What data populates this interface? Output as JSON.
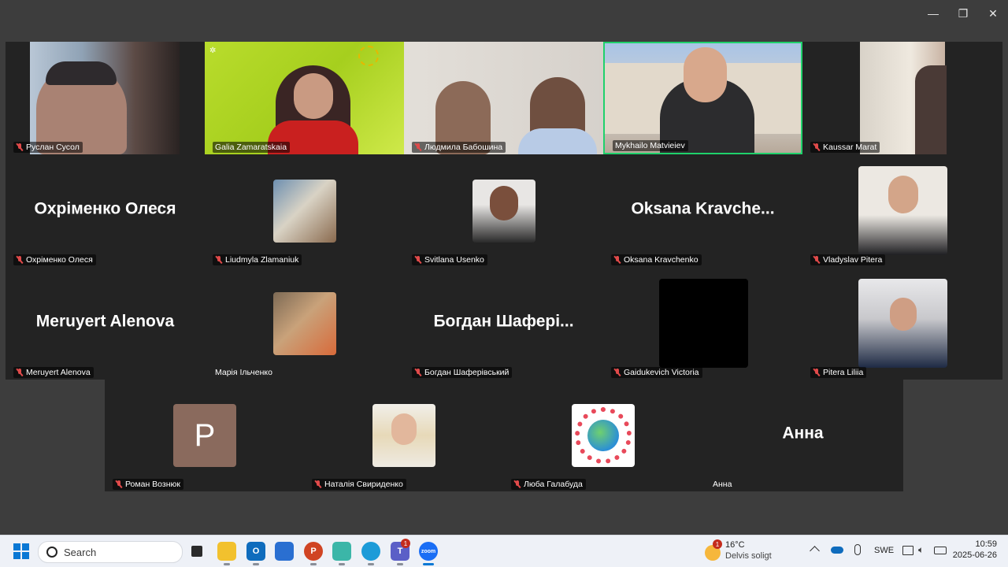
{
  "window_controls": {
    "minimize": "—",
    "maximize": "❐",
    "close": "✕"
  },
  "participants": {
    "row1": [
      {
        "name": "Руслан Сусол"
      },
      {
        "name": "Galia Zamaratskaia"
      },
      {
        "name": "Людмила Бабошина"
      },
      {
        "name": "Mykhailo Matvieiev"
      },
      {
        "name": "Kaussar Marat"
      }
    ],
    "row2": [
      {
        "name": "Охріменко Олеся",
        "big": "Охріменко Олеся"
      },
      {
        "name": "Liudmyla Zlamaniuk"
      },
      {
        "name": "Svitlana Usenko"
      },
      {
        "name": "Oksana Kravchenko",
        "big": "Oksana  Kravche..."
      },
      {
        "name": "Vladyslav Pitera"
      }
    ],
    "row3": [
      {
        "name": "Meruyert Alenova",
        "big": "Meruyert Alenova"
      },
      {
        "name": "Марія Ільченко"
      },
      {
        "name": "Богдан Шаферівський",
        "big": "Богдан  Шафері..."
      },
      {
        "name": "Gaidukevich Victoria"
      },
      {
        "name": "Pitera Liliia"
      }
    ],
    "row4": [
      {
        "name": "Роман Вознюк",
        "initial": "P"
      },
      {
        "name": "Наталія Свириденко"
      },
      {
        "name": "Люба Галабуда"
      },
      {
        "name": "Анна",
        "big": "Анна"
      }
    ]
  },
  "colors": {
    "active_speaker": "#1fd16b",
    "muted": "#e04a4a",
    "avatar_roman": "#8a6a5d"
  },
  "taskbar": {
    "search_placeholder": "Search",
    "weather_temp": "16°C",
    "weather_desc": "Delvis soligt",
    "weather_badge": "1",
    "teams_badge": "1",
    "language": "SWE",
    "time": "10:59",
    "date": "2025-06-26"
  }
}
